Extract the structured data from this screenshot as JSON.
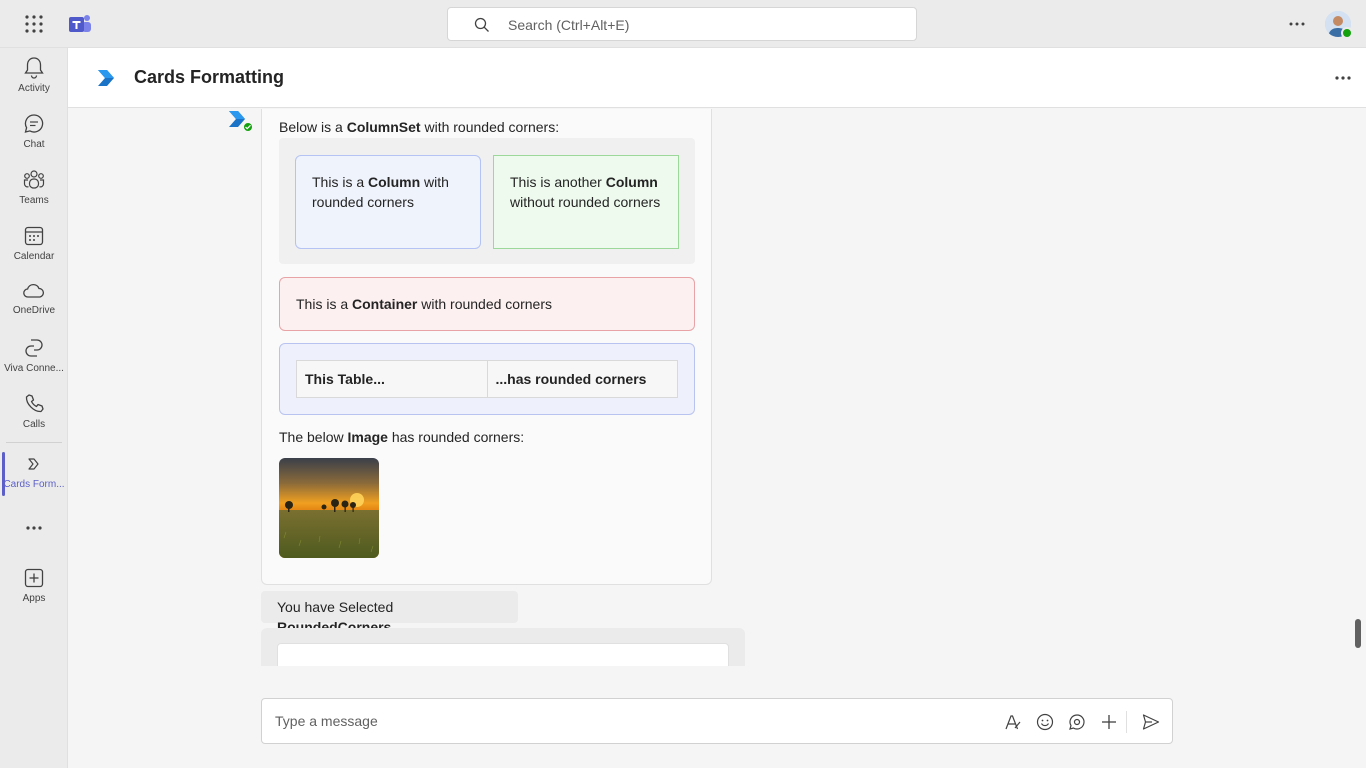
{
  "topbar": {
    "search_placeholder": "Search (Ctrl+Alt+E)"
  },
  "rail": {
    "items": [
      {
        "label": "Activity",
        "icon": "bell-icon"
      },
      {
        "label": "Chat",
        "icon": "chat-icon"
      },
      {
        "label": "Teams",
        "icon": "teams-icon"
      },
      {
        "label": "Calendar",
        "icon": "calendar-icon"
      },
      {
        "label": "OneDrive",
        "icon": "cloud-icon"
      },
      {
        "label": "Viva Conne...",
        "icon": "viva-connections-icon"
      },
      {
        "label": "Calls",
        "icon": "phone-icon"
      },
      {
        "label": "Cards Form...",
        "icon": "app-icon",
        "active": true
      },
      {
        "label": "",
        "icon": "more-apps-icon"
      },
      {
        "label": "Apps",
        "icon": "add-apps-icon"
      }
    ]
  },
  "header": {
    "title": "Cards Formatting"
  },
  "card": {
    "intro_prefix": "Below is a ",
    "intro_bold": "ColumnSet",
    "intro_suffix": " with rounded corners:",
    "column1_prefix": "This is a ",
    "column1_bold": "Column",
    "column1_suffix": " with rounded corners",
    "column2_prefix": "This is another ",
    "column2_bold": "Column",
    "column2_suffix": " without rounded corners",
    "container_prefix": "This is a ",
    "container_bold": "Container",
    "container_suffix": " with rounded corners",
    "table_cell1": "This Table...",
    "table_cell2": "...has rounded corners",
    "image_caption_prefix": "The below ",
    "image_caption_bold": "Image",
    "image_caption_suffix": " has rounded corners:"
  },
  "selection": {
    "prefix": "You have Selected ",
    "bold": "RoundedCorners"
  },
  "composer": {
    "placeholder": "Type a message"
  },
  "colors": {
    "accent": "#5b5fc7",
    "presence": "#13a10e"
  }
}
